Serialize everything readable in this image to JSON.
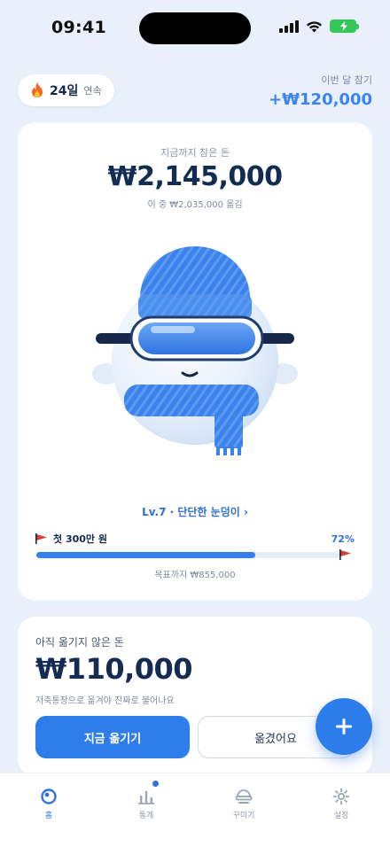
{
  "status_bar": {
    "time": "09:41"
  },
  "header": {
    "streak_days": "24일",
    "streak_suffix": "연속",
    "monthly_label": "이번 달 참기",
    "monthly_value": "+₩120,000"
  },
  "summary": {
    "total_label": "지금까지 참은 돈",
    "total_value": "₩2,145,000",
    "moved_note": "이 중 ₩2,035,000 옮김"
  },
  "character": {
    "level_link": "Lv.7 · 단단한 눈덩이 ›"
  },
  "goal": {
    "name": "첫 300만 원",
    "percent_label": "72%",
    "progress": 0.72,
    "remaining": "목표까지 ₩855,000"
  },
  "pending": {
    "title": "아직 옮기지 않은 돈",
    "amount": "₩110,000",
    "note": "저축통장으로 옮겨야 진짜로 불어나요",
    "move_now_label": "지금 옮기기",
    "done_label": "옮겼어요"
  },
  "tabs": [
    {
      "label": "홈",
      "icon": "snowball-icon",
      "active": true
    },
    {
      "label": "통계",
      "icon": "bar-chart-icon",
      "active": false,
      "badge": true
    },
    {
      "label": "꾸미기",
      "icon": "hat-icon",
      "active": false
    },
    {
      "label": "설정",
      "icon": "gear-icon",
      "active": false
    }
  ],
  "colors": {
    "accent": "#2E7DEA",
    "background": "#E9F0F9",
    "text_dark": "#122C52"
  }
}
